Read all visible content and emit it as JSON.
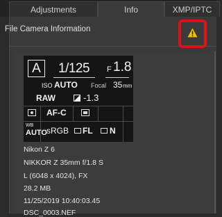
{
  "tabs": [
    {
      "label": "Adjustments"
    },
    {
      "label": "Info"
    },
    {
      "label": "XMP/IPTC"
    }
  ],
  "section_title": "File  Camera Information",
  "warning_icon": "warning-triangle-icon",
  "accent_colors": {
    "highlight_box": "#e01018",
    "warning": "#f2c200"
  },
  "camera": {
    "mode": "A",
    "shutter": "1/125",
    "f_prefix": "F",
    "aperture": "1.8",
    "iso_label": "ISO",
    "iso_value": "AUTO",
    "focal_label": "Focal",
    "focal_value": "35",
    "focal_unit": "mm",
    "quality": "RAW",
    "exposure_comp": "-1.3",
    "af_mode": "AF-C",
    "wb_small": "WB",
    "wb_value": "AUTO",
    "color_space": "sRGB",
    "picture_control": "FL",
    "noise_reduction": "N"
  },
  "file_info": [
    "Nikon Z 6",
    "NIKKOR Z 35mm f/1.8 S",
    "L (6048 x 4024), FX",
    "28.2 MB",
    "11/25/2019 10:40:03.45",
    "DSC_0003.NEF"
  ]
}
